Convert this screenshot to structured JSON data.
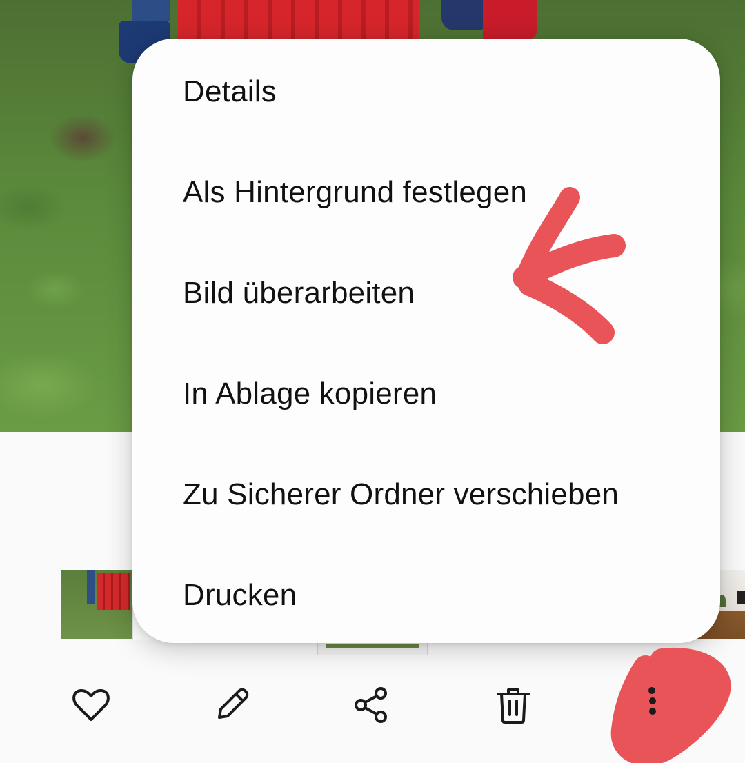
{
  "menu": {
    "items": [
      {
        "label": "Details"
      },
      {
        "label": "Als Hintergrund festlegen"
      },
      {
        "label": "Bild überarbeiten"
      },
      {
        "label": "In Ablage kopieren"
      },
      {
        "label": "Zu Sicherer Ordner verschieben"
      },
      {
        "label": "Drucken"
      }
    ]
  },
  "toolbar": {
    "icons": [
      "heart-icon",
      "pencil-icon",
      "share-icon",
      "trash-icon",
      "more-vertical-icon"
    ]
  },
  "colors": {
    "annotation": "#e85457",
    "menu_background": "#fdfdfd",
    "menu_text": "#111111",
    "icon": "#1b1b1b"
  }
}
